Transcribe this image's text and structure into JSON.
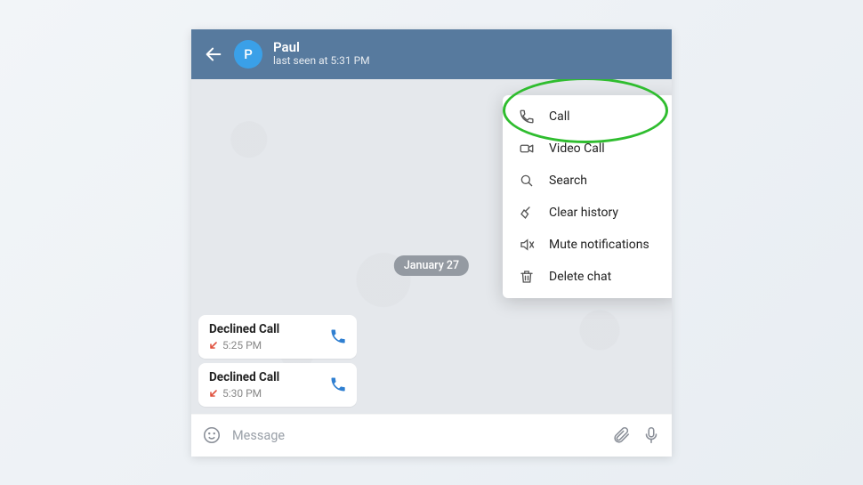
{
  "colors": {
    "header_bg": "#577a9e",
    "avatar_bg": "#3aa0e8",
    "call_action": "#2f7fd1",
    "missed_arrow": "#e0523f"
  },
  "header": {
    "contact_name": "Paul",
    "avatar_initial": "P",
    "status": "last seen at 5:31 PM"
  },
  "chat": {
    "date_label": "January 27",
    "calls": [
      {
        "title": "Declined Call",
        "time": "5:25 PM"
      },
      {
        "title": "Declined Call",
        "time": "5:30 PM"
      }
    ]
  },
  "input": {
    "placeholder": "Message"
  },
  "menu": {
    "items": [
      {
        "icon": "phone",
        "label": "Call"
      },
      {
        "icon": "video",
        "label": "Video Call"
      },
      {
        "icon": "search",
        "label": "Search"
      },
      {
        "icon": "broom",
        "label": "Clear history"
      },
      {
        "icon": "mute",
        "label": "Mute notifications"
      },
      {
        "icon": "trash",
        "label": "Delete chat"
      }
    ]
  }
}
